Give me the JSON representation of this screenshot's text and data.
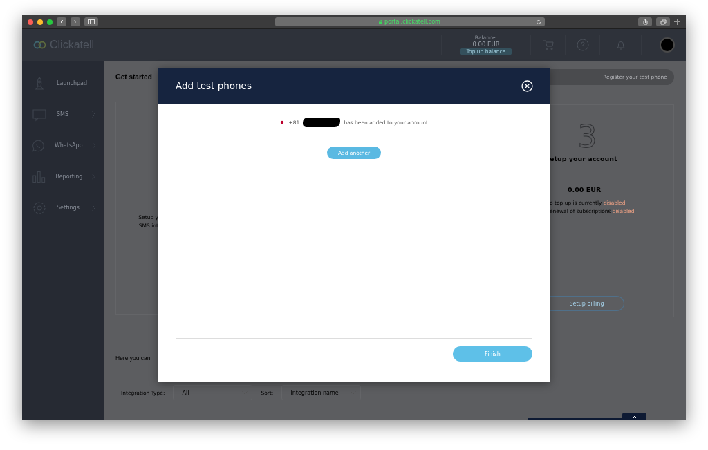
{
  "browser": {
    "url": "portal.clickatell.com"
  },
  "header": {
    "logo": "Clickatell",
    "balance_label": "Balance:",
    "balance": "0.00 EUR",
    "top_up": "Top up balance"
  },
  "sidebar": {
    "items": [
      {
        "label": "Launchpad",
        "kind": "rocket",
        "expandable": false
      },
      {
        "label": "SMS",
        "kind": "chat",
        "expandable": true
      },
      {
        "label": "WhatsApp",
        "kind": "phone",
        "expandable": true
      },
      {
        "label": "Reporting",
        "kind": "bars",
        "expandable": true
      },
      {
        "label": "Settings",
        "kind": "gear",
        "expandable": true
      }
    ]
  },
  "page": {
    "heading": "Get started",
    "register_button": "Register your test phone",
    "left_card": {
      "lines": [
        "Setup y",
        "SMS int"
      ]
    },
    "account_card": {
      "step": "3",
      "title": "etup your account",
      "balance": "0.00 EUR",
      "lines": [
        {
          "text": "o top up is currently",
          "status": "disabled"
        },
        {
          "text": "enewal of subscriptions",
          "status": "disabled"
        }
      ],
      "button": "Setup billing"
    },
    "intro": "Here you can",
    "filters": [
      {
        "label": "Integration Type:",
        "value": "All"
      },
      {
        "label": "Sort:",
        "value": "Integration name"
      }
    ]
  },
  "modal": {
    "title": "Add test phones",
    "message": {
      "prefix": "+81",
      "text": "has been added to your account."
    },
    "add_button": "Add another",
    "finish_button": "Finish"
  }
}
